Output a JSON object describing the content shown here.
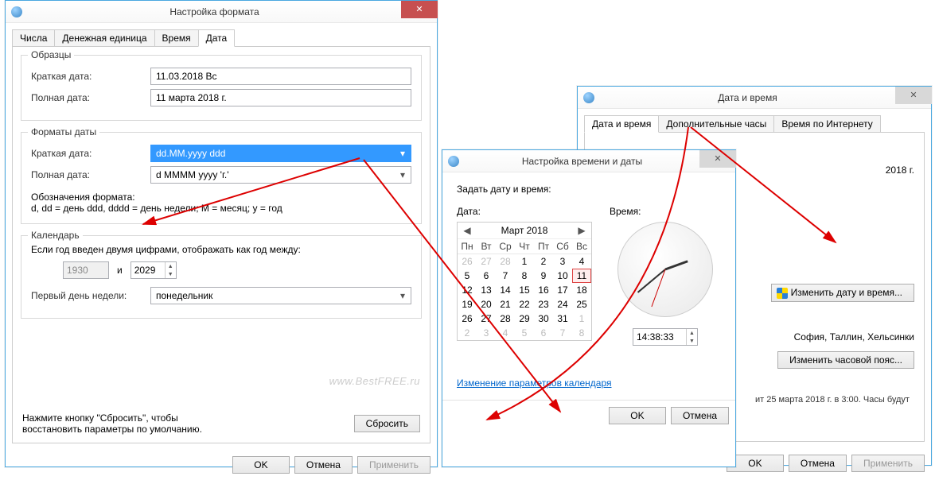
{
  "win1": {
    "title": "Настройка формата",
    "tabs": [
      "Числа",
      "Денежная единица",
      "Время",
      "Дата"
    ],
    "samples": {
      "legend": "Образцы",
      "short_label": "Краткая дата:",
      "short_value": "11.03.2018 Вс",
      "long_label": "Полная дата:",
      "long_value": "11 марта 2018 г."
    },
    "formats": {
      "legend": "Форматы даты",
      "short_label": "Краткая дата:",
      "short_value": "dd.MM.yyyy ddd",
      "long_label": "Полная дата:",
      "long_value": "d MMMM yyyy 'г.'",
      "notation_label": "Обозначения формата:",
      "notation_text": "d, dd = день  ddd, dddd = день недели; M = месяц; y = год"
    },
    "calendar": {
      "legend": "Календарь",
      "twodigit_label": "Если год введен двумя цифрами, отображать как год между:",
      "year_from": "1930",
      "and": "и",
      "year_to": "2029",
      "firstday_label": "Первый день недели:",
      "firstday_value": "понедельник"
    },
    "reset_hint": "Нажмите кнопку \"Сбросить\", чтобы восстановить параметры по умолчанию.",
    "reset_btn": "Сбросить",
    "ok": "OK",
    "cancel": "Отмена",
    "apply": "Применить",
    "watermark": "www.BestFREE.ru"
  },
  "win2": {
    "title": "Настройка времени и даты",
    "set_label": "Задать дату и время:",
    "date_label": "Дата:",
    "time_label": "Время:",
    "cal_month": "Март 2018",
    "cal_headers": [
      "Пн",
      "Вт",
      "Ср",
      "Чт",
      "Пт",
      "Сб",
      "Вс"
    ],
    "cal_rows": [
      [
        {
          "v": "26",
          "g": 1
        },
        {
          "v": "27",
          "g": 1
        },
        {
          "v": "28",
          "g": 1
        },
        {
          "v": "1"
        },
        {
          "v": "2"
        },
        {
          "v": "3"
        },
        {
          "v": "4"
        }
      ],
      [
        {
          "v": "5"
        },
        {
          "v": "6"
        },
        {
          "v": "7"
        },
        {
          "v": "8"
        },
        {
          "v": "9"
        },
        {
          "v": "10"
        },
        {
          "v": "11",
          "sel": 1
        }
      ],
      [
        {
          "v": "12"
        },
        {
          "v": "13"
        },
        {
          "v": "14"
        },
        {
          "v": "15"
        },
        {
          "v": "16"
        },
        {
          "v": "17"
        },
        {
          "v": "18"
        }
      ],
      [
        {
          "v": "19"
        },
        {
          "v": "20"
        },
        {
          "v": "21"
        },
        {
          "v": "22"
        },
        {
          "v": "23"
        },
        {
          "v": "24"
        },
        {
          "v": "25"
        }
      ],
      [
        {
          "v": "26"
        },
        {
          "v": "27"
        },
        {
          "v": "28"
        },
        {
          "v": "29"
        },
        {
          "v": "30"
        },
        {
          "v": "31"
        },
        {
          "v": "1",
          "g": 1
        }
      ],
      [
        {
          "v": "2",
          "g": 1
        },
        {
          "v": "3",
          "g": 1
        },
        {
          "v": "4",
          "g": 1
        },
        {
          "v": "5",
          "g": 1
        },
        {
          "v": "6",
          "g": 1
        },
        {
          "v": "7",
          "g": 1
        },
        {
          "v": "8",
          "g": 1
        }
      ]
    ],
    "time_value": "14:38:33",
    "link": "Изменение параметров календаря",
    "ok": "OK",
    "cancel": "Отмена"
  },
  "win3": {
    "title": "Дата и время",
    "tabs": [
      "Дата и время",
      "Дополнительные часы",
      "Время по Интернету"
    ],
    "date_txt": "2018 г.",
    "change_dt": "Изменить дату и время...",
    "tz_txt": "София, Таллин, Хельсинки",
    "change_tz": "Изменить часовой пояс...",
    "dst_txt": "ит 25 марта 2018 г. в 3:00. Часы будут",
    "ok": "OK",
    "cancel": "Отмена",
    "apply": "Применить"
  }
}
